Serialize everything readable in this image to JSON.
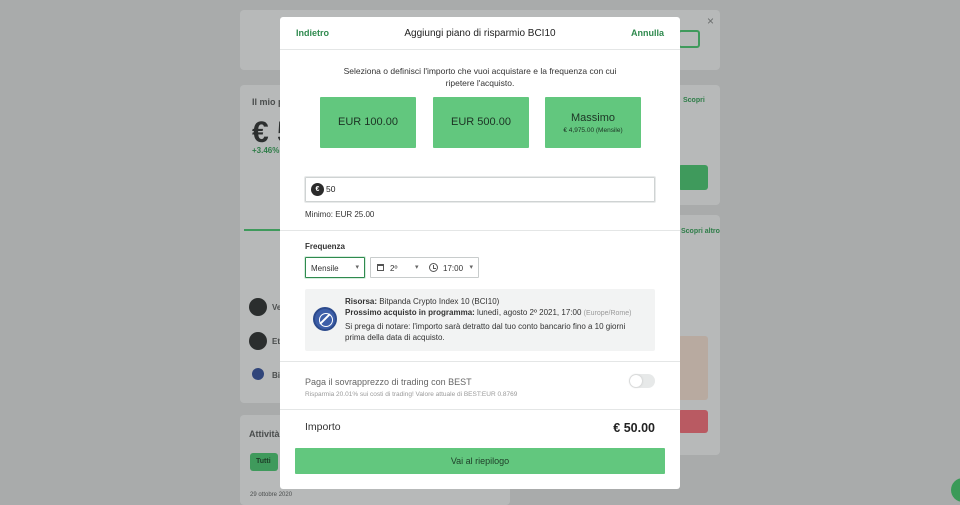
{
  "background": {
    "balance_label": "Il mio p",
    "balance_value": "€ 5",
    "change": "+3.46%",
    "activity_label": "Attività",
    "filter_all": "Tutti",
    "date": "29 ottobre 2020",
    "asset_rows": [
      "Ve",
      "Et",
      "Bi"
    ],
    "right_links": [
      "Scopri",
      "Scopri altro"
    ],
    "close_glyph": "×"
  },
  "modal": {
    "back_label": "Indietro",
    "title": "Aggiungi piano di risparmio BCI10",
    "cancel_label": "Annulla",
    "intro": "Seleziona o definisci l'importo che vuoi acquistare e la frequenza con cui ripetere l'acquisto.",
    "presets": [
      {
        "label": "EUR 100.00"
      },
      {
        "label": "EUR 500.00"
      }
    ],
    "max_preset": {
      "title": "Massimo",
      "sub": "€ 4,975.00 (Mensile)"
    },
    "amount_input": {
      "currency_glyph": "€",
      "value": "50"
    },
    "minimum_text": "Minimo: EUR 25.00",
    "frequency": {
      "label": "Frequenza",
      "interval": "Mensile",
      "day": "2º",
      "time": "17:00"
    },
    "info": {
      "asset_label": "Risorsa:",
      "asset_value": "Bitpanda Crypto Index 10 (BCI10)",
      "next_label": "Prossimo acquisto in programma:",
      "next_value": "lunedì, agosto 2º 2021, 17:00",
      "timezone": "(Europe/Rome)",
      "notice_line1": "Si prega di notare: l'importo sarà detratto dal tuo conto bancario fino a 10 giorni",
      "notice_line2": "prima della data di acquisto."
    },
    "best": {
      "title": "Paga il sovrapprezzo di trading con BEST",
      "subtitle": "Risparmia 20.01% sui costi di trading! Valore attuale di BEST:EUR 0.8769",
      "enabled": false
    },
    "total": {
      "label": "Importo",
      "value": "€ 50.00"
    },
    "cta_label": "Vai al riepilogo"
  },
  "colors": {
    "accent": "#62c77e",
    "link": "#2f8a4e",
    "overlay": "#a9abab"
  }
}
